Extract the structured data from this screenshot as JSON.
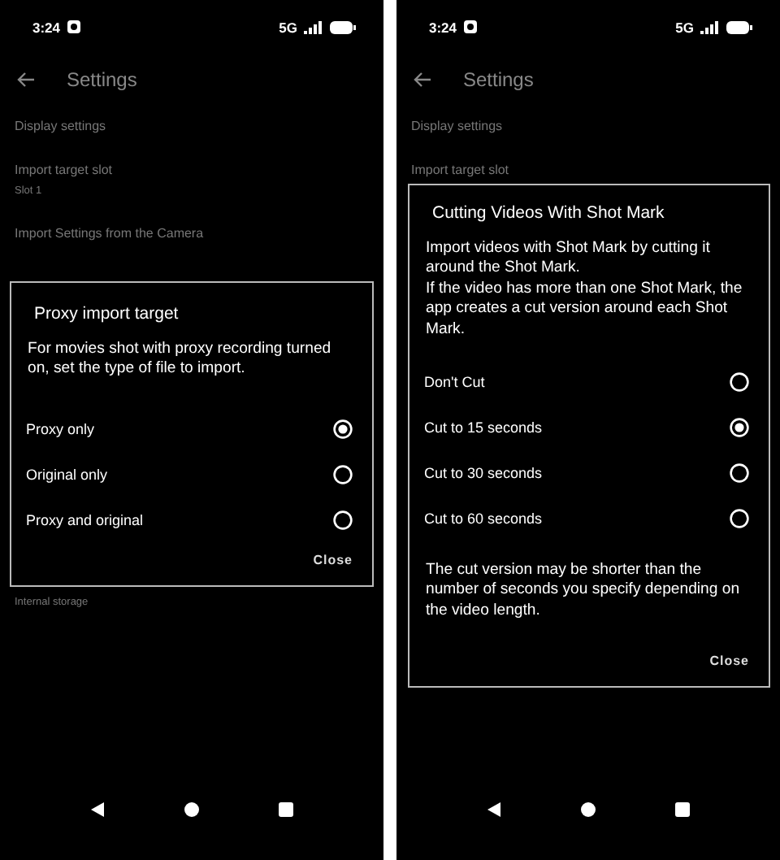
{
  "screens": [
    {
      "status_bar": {
        "time": "3:24",
        "network": "5G"
      },
      "header": {
        "title": "Settings"
      },
      "items": [
        {
          "title": "Display settings"
        },
        {
          "title": "Import target slot",
          "subtitle": "Slot 1"
        },
        {
          "title": "Import Settings from the Camera"
        },
        {
          "subtitle": "Internal storage"
        }
      ],
      "dialog": {
        "title": "Proxy import target",
        "message": "For movies shot with proxy recording turned on, set the type of file to import.",
        "options": [
          {
            "label": "Proxy only",
            "selected": true
          },
          {
            "label": "Original only",
            "selected": false
          },
          {
            "label": "Proxy and original",
            "selected": false
          }
        ],
        "button": "Close"
      }
    },
    {
      "status_bar": {
        "time": "3:24",
        "network": "5G"
      },
      "header": {
        "title": "Settings"
      },
      "items": [
        {
          "title": "Display settings"
        },
        {
          "title": "Import target slot"
        }
      ],
      "dialog": {
        "title": "Cutting Videos With Shot Mark",
        "message": "Import videos with Shot Mark by cutting it around the Shot Mark.\nIf the video has more than one Shot Mark, the app creates a cut version around each Shot Mark.",
        "options": [
          {
            "label": "Don't Cut",
            "selected": false
          },
          {
            "label": "Cut to 15 seconds",
            "selected": true
          },
          {
            "label": "Cut to 30 seconds",
            "selected": false
          },
          {
            "label": "Cut to 60 seconds",
            "selected": false
          }
        ],
        "note": "The cut version may be shorter than the number of seconds you specify depending on the video length.",
        "button": "Close"
      }
    }
  ]
}
